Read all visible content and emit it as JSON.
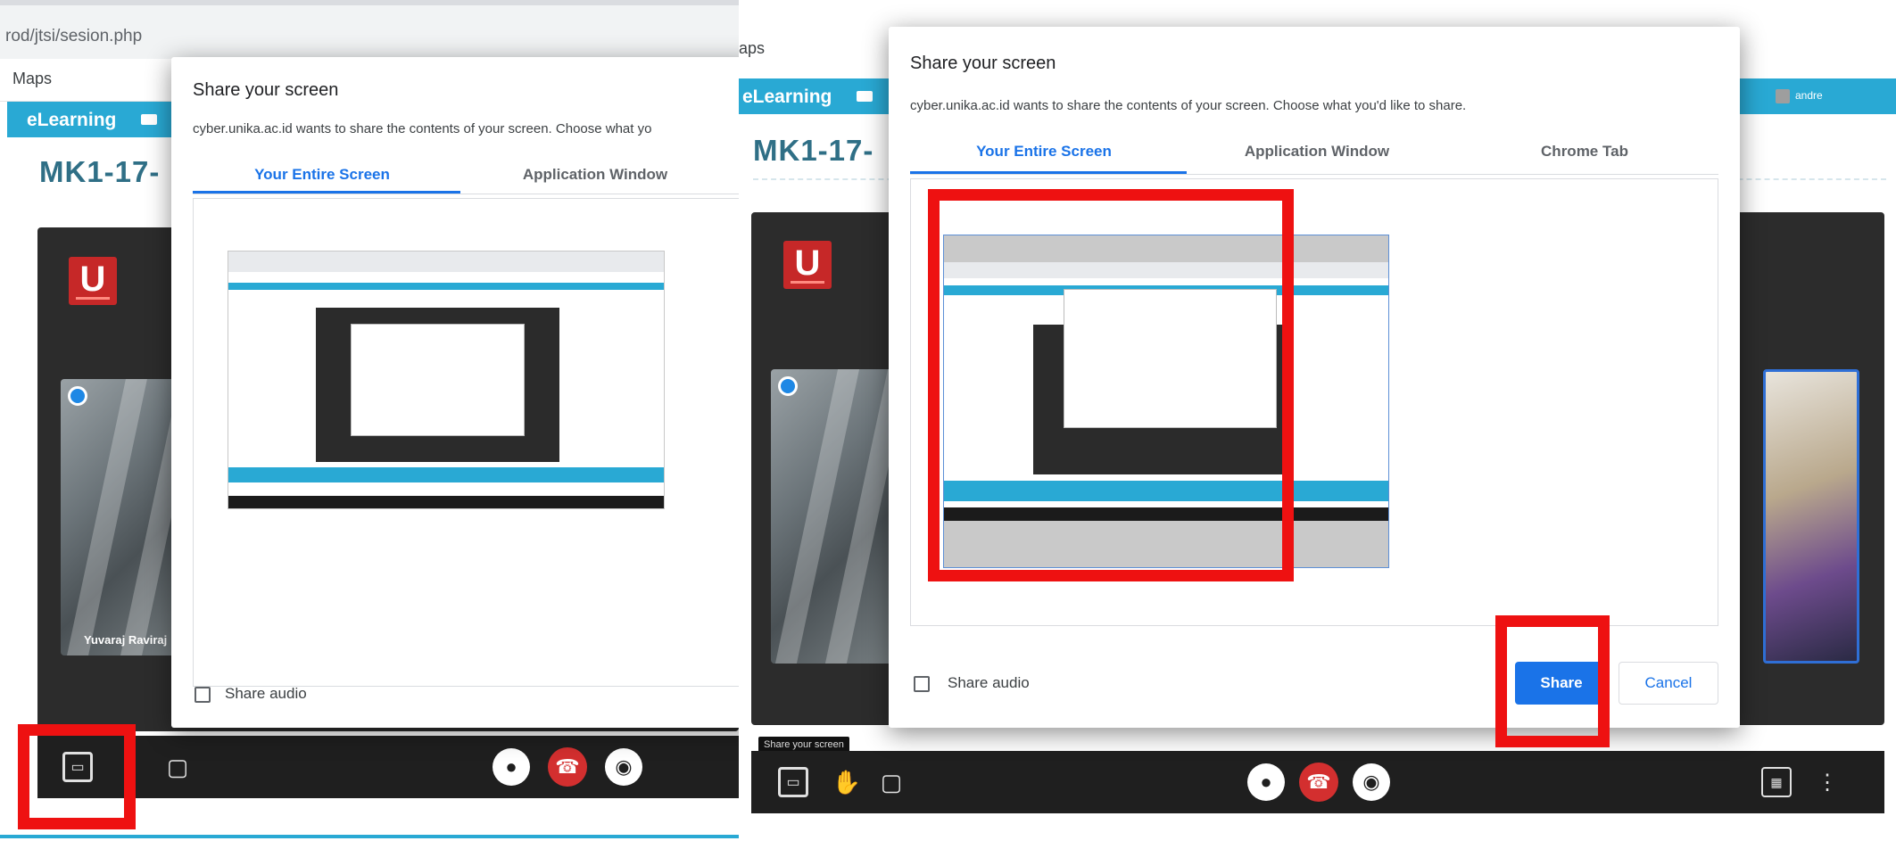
{
  "left": {
    "url": "rod/jtsi/sesion.php",
    "bookmark": "Maps",
    "lms_brand": "eLearning",
    "course_title": "MK1-17-",
    "cam_name": "Yuvaraj Raviraj",
    "dialog": {
      "title": "Share your screen",
      "subtitle": "cyber.unika.ac.id wants to share the contents of your screen. Choose what yo",
      "tabs": [
        "Your Entire Screen",
        "Application Window"
      ],
      "active_tab": 0,
      "share_audio_label": "Share audio"
    },
    "icons": [
      "screen-share-icon",
      "chat-icon",
      "mic-icon",
      "hangup-icon",
      "camera-icon"
    ]
  },
  "right": {
    "bookmark": "aps",
    "lms_brand": "eLearning",
    "course_title": "MK1-17-",
    "user_name": "andre",
    "tooltip": "Share your screen",
    "dialog": {
      "title": "Share your screen",
      "subtitle": "cyber.unika.ac.id wants to share the contents of your screen. Choose what you'd like to share.",
      "tabs": [
        "Your Entire Screen",
        "Application Window",
        "Chrome Tab"
      ],
      "active_tab": 0,
      "share_audio_label": "Share audio",
      "share_label": "Share",
      "cancel_label": "Cancel"
    },
    "icons": [
      "screen-share-icon",
      "raise-hand-icon",
      "chat-icon",
      "mic-icon",
      "hangup-icon",
      "camera-icon",
      "grid-view-icon",
      "more-vert-icon"
    ]
  },
  "colors": {
    "accent": "#1a73e8",
    "lms_cyan": "#29a9d4",
    "highlight_red": "#ee1111",
    "hangup_red": "#d32f2f"
  }
}
